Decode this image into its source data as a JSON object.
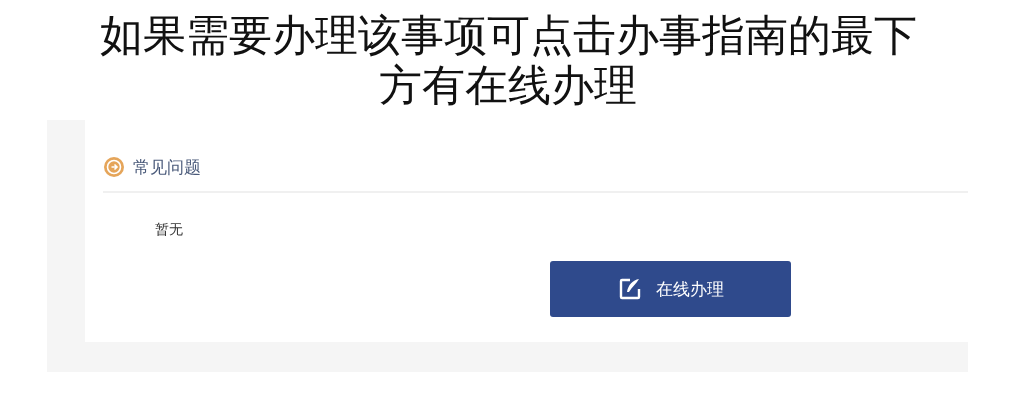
{
  "caption": {
    "lines": [
      "如果需要办理该事项可点击办事指南的最下",
      "方有在线办理"
    ]
  },
  "faq": {
    "title": "常见问题",
    "content": "暂无"
  },
  "online_button": {
    "label": "在线办理"
  }
}
